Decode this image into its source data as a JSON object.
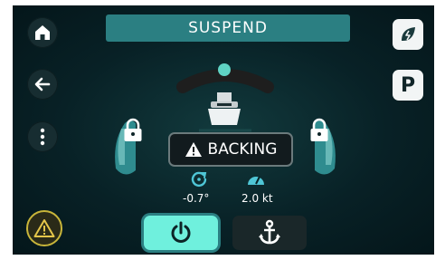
{
  "status": {
    "mode_label": "SUSPEND",
    "alert_text": "BACKING"
  },
  "readouts": {
    "rotation": "-0.7°",
    "speed": "2.0 kt"
  },
  "icons": {
    "home": "home-icon",
    "back": "arrow-left-icon",
    "menu": "more-vertical-icon",
    "warning": "warning-icon",
    "eco": "leaf-icon",
    "park": "P",
    "lock": "lock-icon",
    "boat": "boat-icon",
    "rotate": "rotate-icon",
    "speed": "speedometer-icon",
    "power": "power-icon",
    "anchor": "anchor-icon"
  },
  "colors": {
    "mode_bar": "#2b7f82",
    "accent": "#5fd3c4",
    "power_active": "#6ff0dd",
    "warning": "#e5c64a"
  }
}
